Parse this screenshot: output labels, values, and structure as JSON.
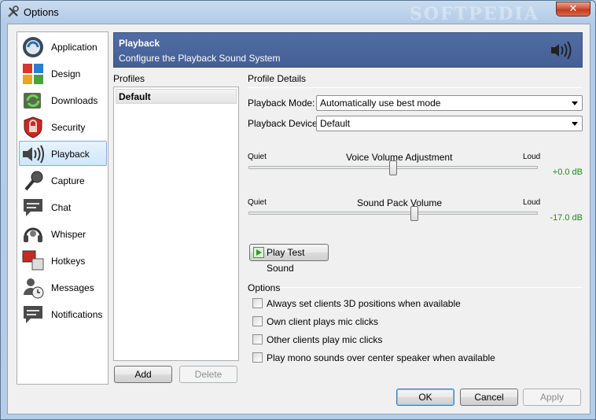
{
  "window": {
    "title": "Options",
    "close_glyph": "✕",
    "watermark": "SOFTPEDIA"
  },
  "sidebar": {
    "items": [
      {
        "label": "Application",
        "icon": "application-icon"
      },
      {
        "label": "Design",
        "icon": "design-icon"
      },
      {
        "label": "Downloads",
        "icon": "downloads-icon"
      },
      {
        "label": "Security",
        "icon": "security-icon"
      },
      {
        "label": "Playback",
        "icon": "playback-icon"
      },
      {
        "label": "Capture",
        "icon": "capture-icon"
      },
      {
        "label": "Chat",
        "icon": "chat-icon"
      },
      {
        "label": "Whisper",
        "icon": "whisper-icon"
      },
      {
        "label": "Hotkeys",
        "icon": "hotkeys-icon"
      },
      {
        "label": "Messages",
        "icon": "messages-icon"
      },
      {
        "label": "Notifications",
        "icon": "notifications-icon"
      }
    ],
    "selected": "Playback"
  },
  "banner": {
    "title": "Playback",
    "subtitle": "Configure the Playback Sound System",
    "icon": "speaker-icon"
  },
  "profiles": {
    "label": "Profiles",
    "items": [
      "Default"
    ],
    "add_label": "Add",
    "delete_label": "Delete"
  },
  "details": {
    "label": "Profile Details",
    "mode_label": "Playback Mode:",
    "mode_value": "Automatically use best mode",
    "device_label": "Playback Device:",
    "device_value": "Default",
    "voice": {
      "quiet": "Quiet",
      "title": "Voice Volume Adjustment",
      "loud": "Loud",
      "value_text": "+0.0 dB",
      "level": 0.5
    },
    "pack": {
      "quiet": "Quiet",
      "title": "Sound Pack Volume",
      "loud": "Loud",
      "value_text": "-17.0 dB",
      "level": 0.57
    },
    "test_button": "Play Test Sound"
  },
  "options": {
    "label": "Options",
    "items": [
      {
        "label": "Always set clients 3D positions when available",
        "checked": false
      },
      {
        "label": "Own client plays mic clicks",
        "checked": false
      },
      {
        "label": "Other clients play mic clicks",
        "checked": false
      },
      {
        "label": "Play mono sounds over center speaker when available",
        "checked": false
      }
    ]
  },
  "footer": {
    "ok": "OK",
    "cancel": "Cancel",
    "apply": "Apply"
  },
  "colors": {
    "banner": "#4a6599",
    "db_text": "#1b8a1b",
    "selection": "#cfe6fb"
  }
}
